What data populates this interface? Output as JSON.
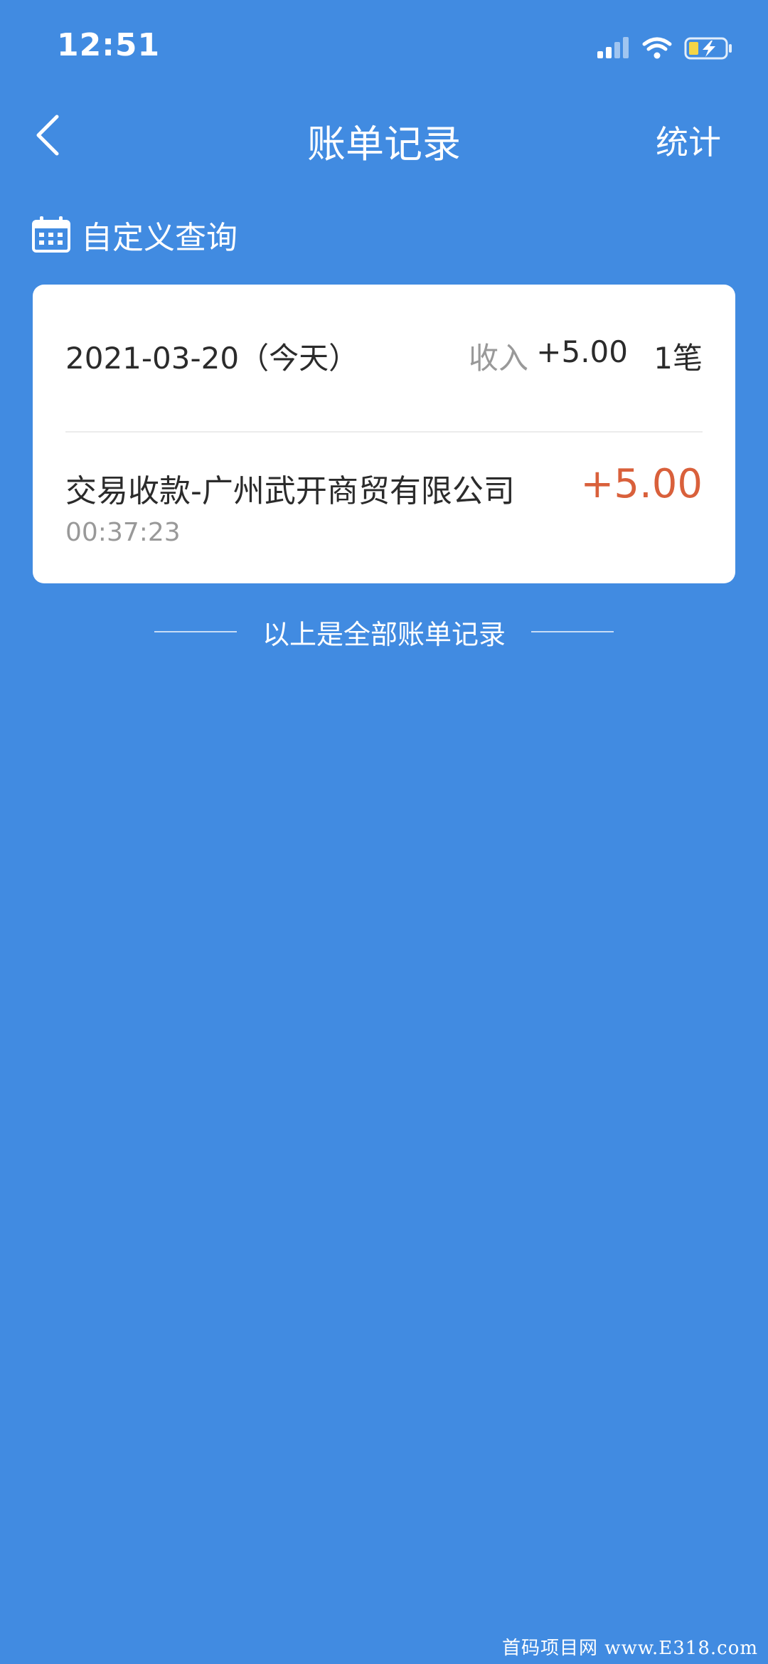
{
  "status_bar": {
    "time": "12:51"
  },
  "nav": {
    "title": "账单记录",
    "stats_label": "统计"
  },
  "query": {
    "label": "自定义查询"
  },
  "day_group": {
    "date": "2021-03-20（今天）",
    "income_label": "收入",
    "income_amount": "+5.00",
    "count": "1笔"
  },
  "transactions": [
    {
      "title": "交易收款-广州武开商贸有限公司",
      "time": "00:37:23",
      "amount": "+5.00"
    }
  ],
  "footer": {
    "note": "以上是全部账单记录"
  },
  "watermark": "首码项目网 www.E318.com",
  "colors": {
    "background": "#418BE1",
    "card": "#FFFFFF",
    "amount": "#D9603B",
    "muted_text": "#999999"
  },
  "icons": {
    "back": "chevron-left-icon",
    "calendar": "calendar-icon",
    "signal": "cellular-signal-icon",
    "wifi": "wifi-icon",
    "battery": "battery-charging-icon"
  }
}
